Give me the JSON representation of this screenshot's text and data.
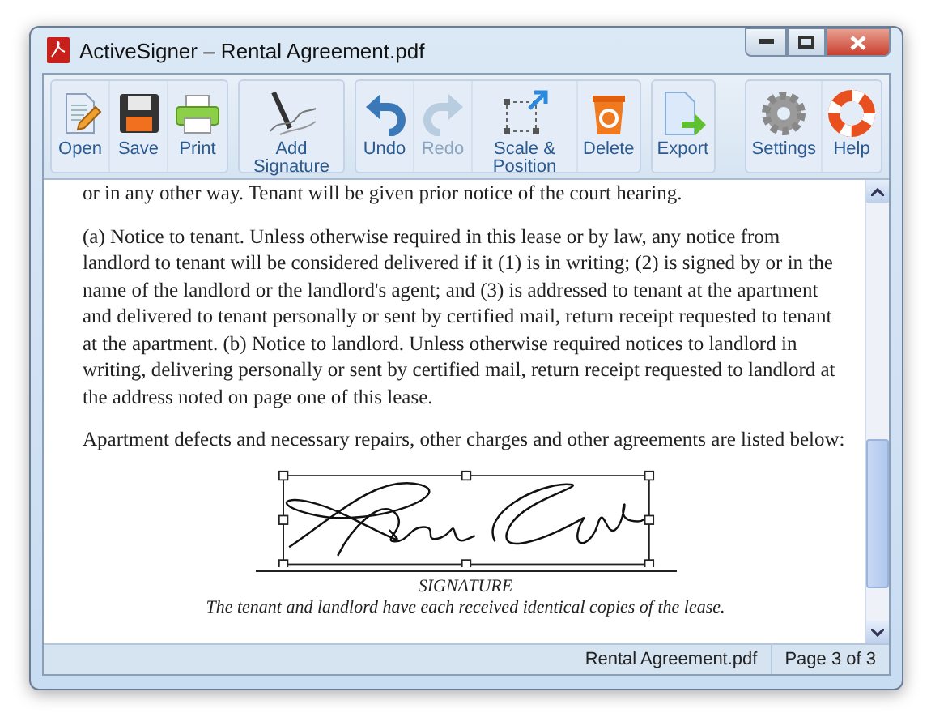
{
  "window": {
    "title": "ActiveSigner – Rental Agreement.pdf"
  },
  "toolbar": {
    "groups": [
      {
        "buttons": [
          {
            "label": "Open",
            "kind": "open",
            "disabled": false
          },
          {
            "label": "Save",
            "kind": "save",
            "disabled": false
          },
          {
            "label": "Print",
            "kind": "print",
            "disabled": false
          }
        ]
      },
      {
        "buttons": [
          {
            "label": "Add Signature",
            "kind": "signature",
            "disabled": false
          }
        ]
      },
      {
        "buttons": [
          {
            "label": "Undo",
            "kind": "undo",
            "disabled": false
          },
          {
            "label": "Redo",
            "kind": "redo",
            "disabled": true
          },
          {
            "label": "Scale & Position",
            "kind": "scale",
            "disabled": false
          },
          {
            "label": "Delete",
            "kind": "delete",
            "disabled": false
          }
        ]
      },
      {
        "buttons": [
          {
            "label": "Export",
            "kind": "export",
            "disabled": false
          }
        ]
      },
      {
        "buttons": [
          {
            "label": "Settings",
            "kind": "settings",
            "disabled": false
          },
          {
            "label": "Help",
            "kind": "help",
            "disabled": false
          }
        ]
      }
    ]
  },
  "document": {
    "paragraphs": [
      "or in any other way. Tenant will be given prior notice of the court hearing.",
      "(a) Notice to tenant. Unless otherwise required in this lease or by law, any notice from landlord to tenant will be considered delivered if it (1) is in writing; (2) is signed by or in the name of the landlord or the landlord's agent; and (3) is addressed to tenant at the apartment and delivered to tenant personally or sent by certified mail, return receipt requested to tenant at the apartment. (b) Notice to landlord. Unless otherwise required notices to landlord in writing, delivering personally or sent by certified mail, return receipt requested to landlord at the address noted on page one of this lease.",
      "Apartment defects and necessary repairs, other charges and other agreements are listed below:"
    ],
    "signature": {
      "selected": true,
      "caption": "SIGNATURE"
    },
    "note": "The tenant and landlord have each received identical copies of the lease."
  },
  "status_bar": {
    "file": "Rental Agreement.pdf",
    "page": "Page 3 of 3"
  }
}
